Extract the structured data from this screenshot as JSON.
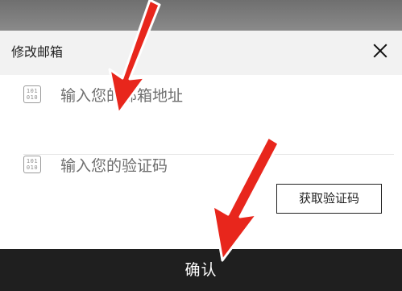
{
  "dialog": {
    "title": "修改邮箱",
    "close_icon": "close-icon",
    "email": {
      "placeholder": "输入您的邮箱地址",
      "value": "",
      "icon": "binary-keypad-icon"
    },
    "code": {
      "placeholder": "输入您的验证码",
      "value": "",
      "icon": "binary-keypad-icon"
    },
    "get_code_label": "获取验证码",
    "confirm_label": "确认"
  },
  "annotations": {
    "arrow_color": "#e8261c",
    "icon_glyph": "101\n010"
  }
}
